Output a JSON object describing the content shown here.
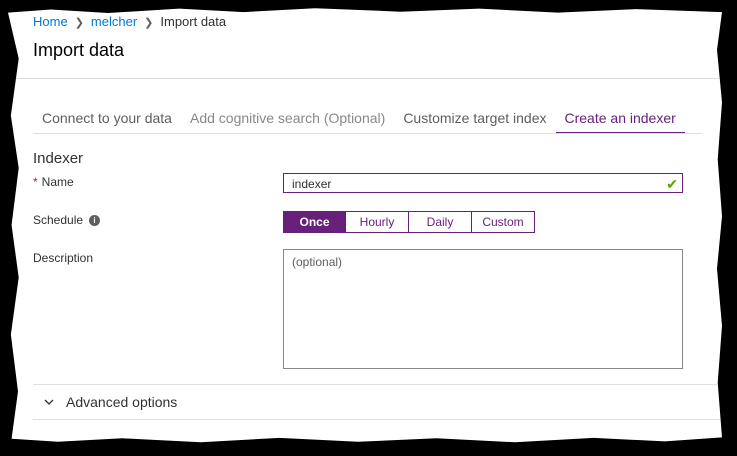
{
  "breadcrumb": {
    "items": [
      "Home",
      "melcher",
      "Import data"
    ]
  },
  "page": {
    "title": "Import data"
  },
  "tabs": [
    {
      "label": "Connect to your data",
      "state": "done"
    },
    {
      "label": "Add cognitive search (Optional)",
      "state": "disabled"
    },
    {
      "label": "Customize target index",
      "state": "done"
    },
    {
      "label": "Create an indexer",
      "state": "active"
    }
  ],
  "indexer": {
    "section_title": "Indexer",
    "name_label": "Name",
    "required_mark": "*",
    "name_value": "indexer",
    "schedule_label": "Schedule",
    "schedule_options": [
      "Once",
      "Hourly",
      "Daily",
      "Custom"
    ],
    "schedule_selected": "Once",
    "description_label": "Description",
    "description_placeholder": "(optional)"
  },
  "advanced": {
    "label": "Advanced options"
  },
  "colors": {
    "accent": "#68217a",
    "link": "#0078d4",
    "valid": "#57a300",
    "required": "#a4262c"
  },
  "icons": {
    "info": "info-icon",
    "check": "check-icon",
    "chevron": "chevron-down-icon",
    "separator": "chevron-right-icon"
  }
}
